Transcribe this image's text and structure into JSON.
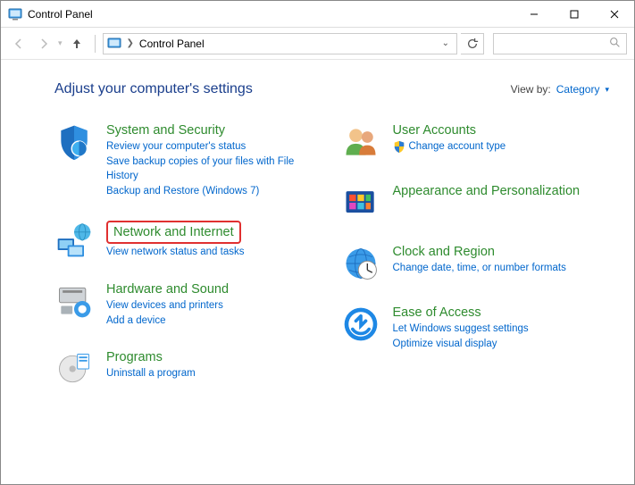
{
  "window": {
    "title": "Control Panel"
  },
  "breadcrumb": {
    "current": "Control Panel"
  },
  "search": {
    "placeholder": ""
  },
  "header": {
    "title": "Adjust your computer's settings"
  },
  "viewby": {
    "label": "View by:",
    "value": "Category"
  },
  "left": [
    {
      "id": "system-security",
      "title": "System and Security",
      "links": [
        "Review your computer's status",
        "Save backup copies of your files with File History",
        "Backup and Restore (Windows 7)"
      ]
    },
    {
      "id": "network-internet",
      "title": "Network and Internet",
      "highlighted": true,
      "links": [
        "View network status and tasks"
      ]
    },
    {
      "id": "hardware-sound",
      "title": "Hardware and Sound",
      "links": [
        "View devices and printers",
        "Add a device"
      ]
    },
    {
      "id": "programs",
      "title": "Programs",
      "links": [
        "Uninstall a program"
      ]
    }
  ],
  "right": [
    {
      "id": "user-accounts",
      "title": "User Accounts",
      "links": [
        {
          "text": "Change account type",
          "shield": true
        }
      ]
    },
    {
      "id": "appearance",
      "title": "Appearance and Personalization",
      "links": []
    },
    {
      "id": "clock-region",
      "title": "Clock and Region",
      "links": [
        "Change date, time, or number formats"
      ]
    },
    {
      "id": "ease-of-access",
      "title": "Ease of Access",
      "links": [
        "Let Windows suggest settings",
        "Optimize visual display"
      ]
    }
  ]
}
